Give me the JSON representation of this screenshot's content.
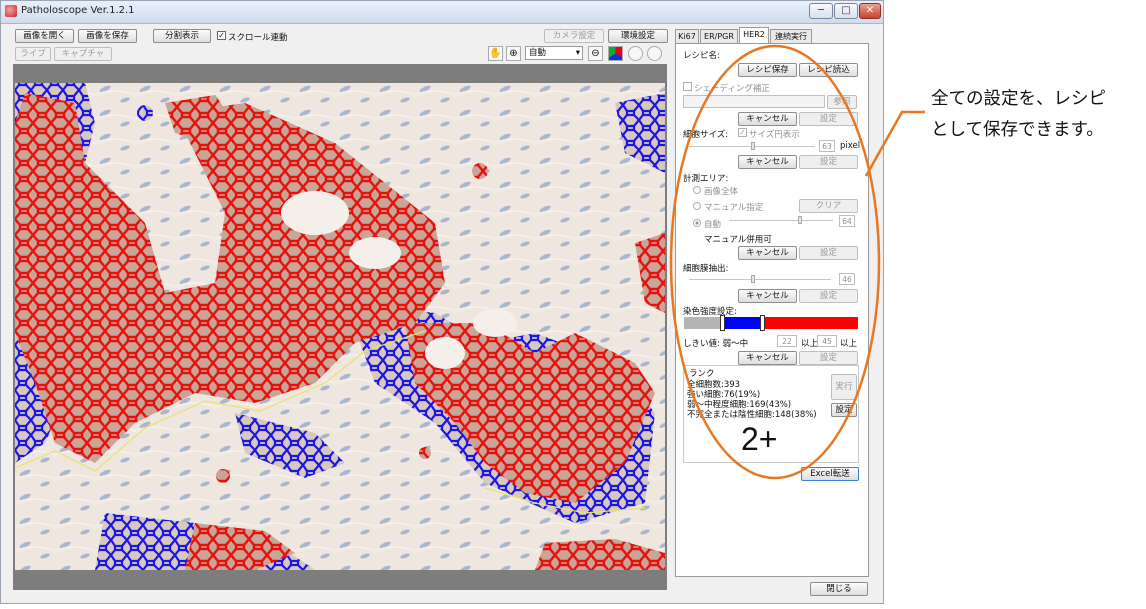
{
  "window": {
    "title": "Patholoscope Ver.1.2.1",
    "minimize_label": "─",
    "maximize_label": "□",
    "close_label": "✕"
  },
  "toolbar": {
    "open_image": "画像を開く",
    "save_image": "画像を保存",
    "split_view": "分割表示",
    "scroll_sync_label": "スクロール連動",
    "scroll_sync_checked": true,
    "live": "ライブ",
    "capture": "キャプチャ",
    "camera_settings": "カメラ設定",
    "env_settings": "環境設定",
    "zoom_mode": "自動",
    "zoom_arrow": "▾"
  },
  "tabs": [
    {
      "label": "Ki67",
      "active": false
    },
    {
      "label": "ER/PGR",
      "active": false
    },
    {
      "label": "HER2",
      "active": true
    },
    {
      "label": "連続実行",
      "active": false
    }
  ],
  "panel": {
    "recipe_name_label": "レシピ名:",
    "recipe_save": "レシピ保存",
    "recipe_load": "レシピ読込",
    "shading_label": "シェーディング補正",
    "browse": "参照",
    "cancel": "キャンセル",
    "set": "設定",
    "cell_size_label": "細胞サイズ:",
    "size_circle_label": "サイズ円表示",
    "cell_size_value": "63",
    "cell_size_unit": "pixel",
    "measure_area_label": "計測エリア:",
    "whole_image": "画像全体",
    "manual_spec": "マニュアル指定",
    "clear": "クリア",
    "auto": "自動",
    "auto_value": "64",
    "manual_combo": "マニュアル併用可",
    "membrane_label": "細胞膜抽出:",
    "membrane_value": "46",
    "stain_label": "染色強度設定:",
    "threshold_label": "しきい値: 弱～中",
    "weak_value": "22",
    "above": "以上",
    "strong_label": "強",
    "strong_value": "45",
    "rank_label": "ランク",
    "total_cells": "全細胞数:393",
    "strong_cells": "強い細胞:76(19%)",
    "medium_cells": "弱～中程度細胞:169(43%)",
    "negative_cells": "不完全または陰性細胞:148(38%)",
    "run": "実行",
    "settings": "設定",
    "score": "2+",
    "excel": "Excel転送"
  },
  "footer": {
    "close": "閉じる"
  },
  "callout": {
    "line1": "全ての設定を、レシピ",
    "line2": "として保存できます。"
  },
  "colors": {
    "strong": "#ff0000",
    "medium": "#0000ff",
    "weak": "#b4b4b4",
    "highlight_ellipse": "#e87722"
  }
}
